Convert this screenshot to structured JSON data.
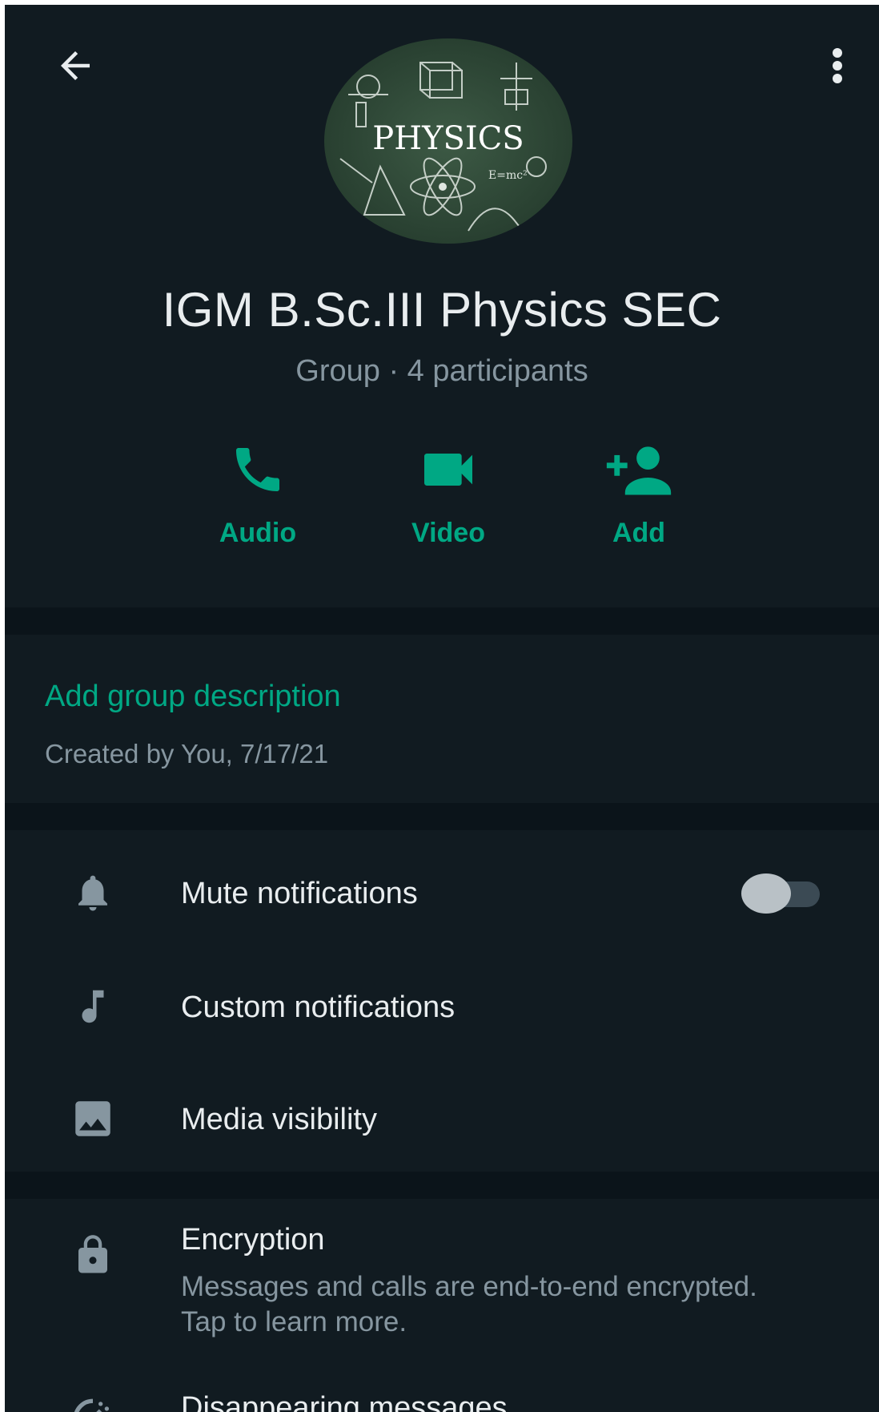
{
  "header": {
    "back_icon": "arrow-left-icon",
    "menu_icon": "more-vert-icon",
    "avatar_text": "PHYSICS"
  },
  "group": {
    "title": "IGM B.Sc.III Physics SEC",
    "subtitle": "Group · 4 participants"
  },
  "actions": [
    {
      "label": "Audio",
      "icon": "phone-icon"
    },
    {
      "label": "Video",
      "icon": "videocam-icon"
    },
    {
      "label": "Add",
      "icon": "person-add-icon"
    }
  ],
  "description": {
    "link": "Add group description",
    "created": "Created by You, 7/17/21"
  },
  "settings": [
    {
      "label": "Mute notifications",
      "icon": "bell-icon",
      "toggle_on": false
    },
    {
      "label": "Custom notifications",
      "icon": "music-note-icon"
    },
    {
      "label": "Media visibility",
      "icon": "image-icon"
    }
  ],
  "encryption": {
    "title": "Encryption",
    "description": "Messages and calls are end-to-end encrypted. Tap to learn more.",
    "icon": "lock-icon"
  },
  "disappearing": {
    "label": "Disappearing messages",
    "icon": "timer-icon"
  },
  "colors": {
    "background": "#111b21",
    "band": "#0b141a",
    "accent": "#00a884",
    "primary_text": "#e9edef",
    "secondary_text": "#8696a0"
  }
}
